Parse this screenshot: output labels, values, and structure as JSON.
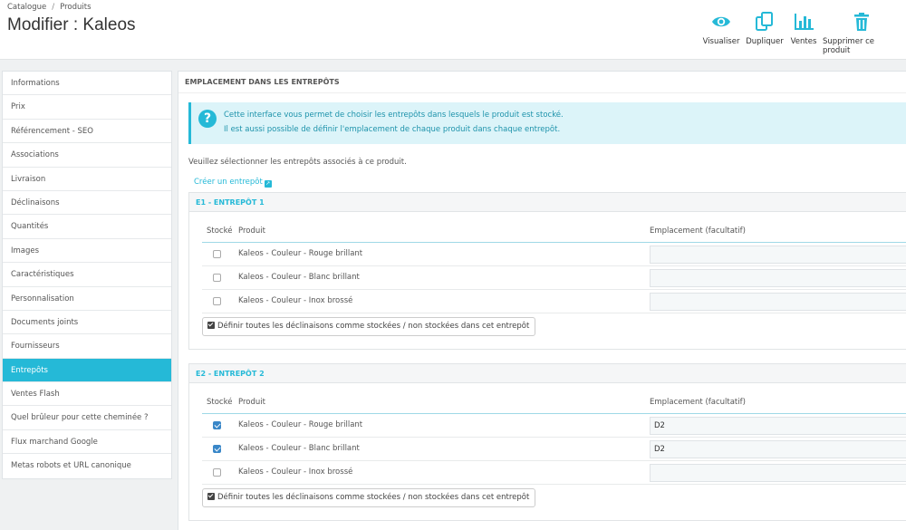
{
  "header": {
    "breadcrumb": [
      "Catalogue",
      "Produits"
    ],
    "breadcrumb_sep": "/",
    "title": "Modifier : Kaleos",
    "toolbar": [
      {
        "label": "Visualiser",
        "icon": "eye-icon"
      },
      {
        "label": "Dupliquer",
        "icon": "duplicate-icon"
      },
      {
        "label": "Ventes",
        "icon": "bar-chart-icon"
      },
      {
        "label": "Supprimer ce produit",
        "icon": "trash-icon"
      }
    ],
    "accent_color": "#25b9d7"
  },
  "sidebar": {
    "items": [
      {
        "label": "Informations"
      },
      {
        "label": "Prix"
      },
      {
        "label": "Référencement - SEO"
      },
      {
        "label": "Associations"
      },
      {
        "label": "Livraison"
      },
      {
        "label": "Déclinaisons"
      },
      {
        "label": "Quantités"
      },
      {
        "label": "Images"
      },
      {
        "label": "Caractéristiques"
      },
      {
        "label": "Personnalisation"
      },
      {
        "label": "Documents joints"
      },
      {
        "label": "Fournisseurs"
      },
      {
        "label": "Entrepôts",
        "active": true
      },
      {
        "label": "Ventes Flash"
      },
      {
        "label": "Quel brûleur pour cette cheminée ?"
      },
      {
        "label": "Flux marchand Google"
      },
      {
        "label": "Metas robots et URL canonique"
      }
    ]
  },
  "main": {
    "heading": "EMPLACEMENT DANS LES ENTREPÔTS",
    "alert_line1": "Cette interface vous permet de choisir les entrepôts dans lesquels le produit est stocké.",
    "alert_line2": "Il est aussi possible de définir l'emplacement de chaque produit dans chaque entrepôt.",
    "intro": "Veuillez sélectionner les entrepôts associés à ce produit.",
    "create_link": "Créer un entrepôt",
    "columns": {
      "stock": "Stocké",
      "product": "Produit",
      "location": "Emplacement (facultatif)"
    },
    "bulk_label": "Définir toutes les déclinaisons comme stockées / non stockées dans cet entrepôt",
    "warehouses": [
      {
        "title": "E1 - ENTREPÔT 1",
        "rows": [
          {
            "product": "Kaleos - Couleur - Rouge brillant",
            "stocked": false,
            "location": ""
          },
          {
            "product": "Kaleos - Couleur - Blanc brillant",
            "stocked": false,
            "location": ""
          },
          {
            "product": "Kaleos - Couleur - Inox brossé",
            "stocked": false,
            "location": ""
          }
        ]
      },
      {
        "title": "E2 - ENTREPÔT 2",
        "rows": [
          {
            "product": "Kaleos - Couleur - Rouge brillant",
            "stocked": true,
            "location": "D2"
          },
          {
            "product": "Kaleos - Couleur - Blanc brillant",
            "stocked": true,
            "location": "D2"
          },
          {
            "product": "Kaleos - Couleur - Inox brossé",
            "stocked": false,
            "location": ""
          }
        ]
      }
    ]
  }
}
